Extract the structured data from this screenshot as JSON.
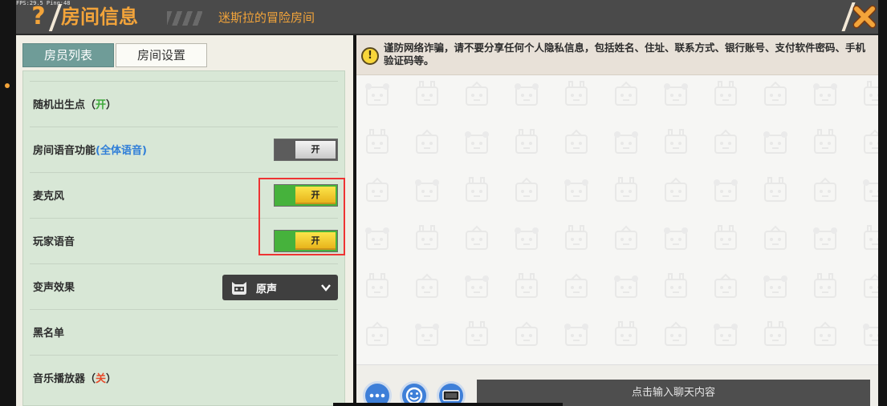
{
  "fps_overlay": "FPS:29.5  Ping:48",
  "header": {
    "help_glyph": "?",
    "title": "房间信息",
    "room_name": "迷斯拉的冒险房间"
  },
  "tabs": [
    {
      "label": "房员列表",
      "active": false
    },
    {
      "label": "房间设置",
      "active": true
    }
  ],
  "settings": {
    "random_spawn": {
      "label": "随机出生点",
      "state": "开"
    },
    "room_voice": {
      "label": "房间语音功能",
      "mode": "全体语音",
      "toggle_label": "开",
      "enabled": false
    },
    "microphone": {
      "label": "麦克风",
      "toggle_label": "开",
      "enabled": true
    },
    "player_voice": {
      "label": "玩家语音",
      "toggle_label": "开",
      "enabled": true
    },
    "voice_effect": {
      "label": "变声效果",
      "selected": "原声"
    },
    "blacklist": {
      "label": "黑名单"
    },
    "music_player": {
      "label": "音乐播放器",
      "state": "关"
    }
  },
  "notice": {
    "text": "谨防网络诈骗，请不要分享任何个人隐私信息，包括姓名、住址、联系方式、银行账号、支付软件密码、手机验证码等。"
  },
  "chat": {
    "input_placeholder": "点击输入聊天内容"
  },
  "colors": {
    "accent_orange": "#f3a43a",
    "toggle_on": "#46b23c",
    "knob_on": "#f0c42a",
    "highlight": "#ee3333"
  }
}
